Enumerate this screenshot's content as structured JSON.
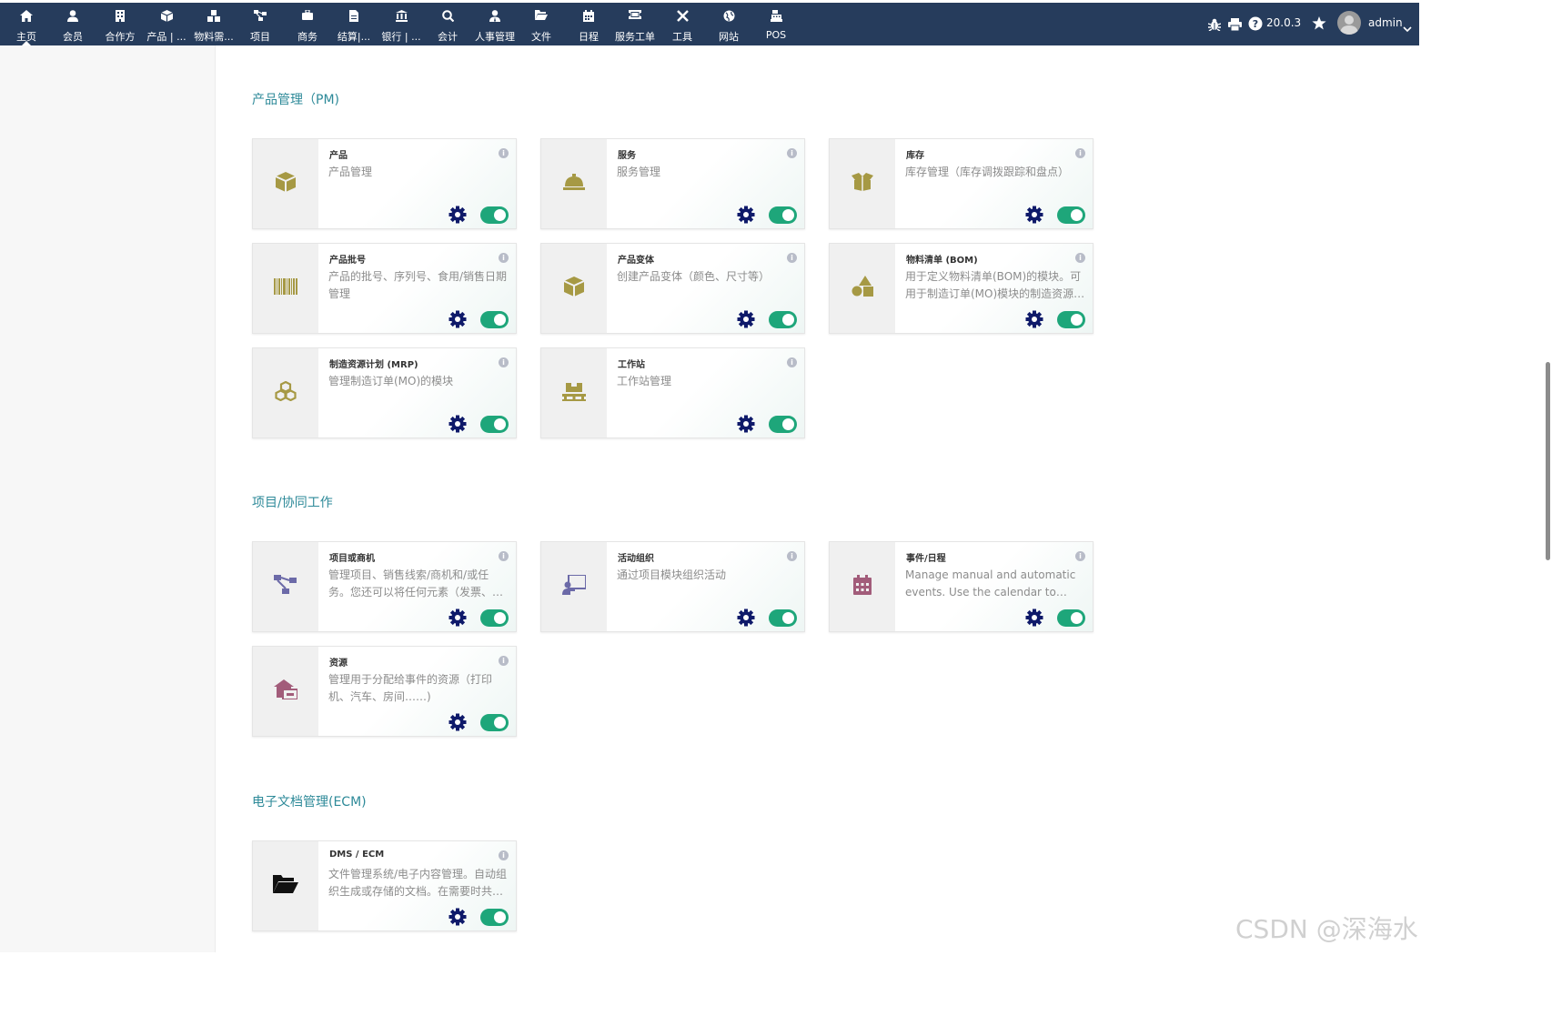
{
  "nav": {
    "items": [
      {
        "label": "主页",
        "icon": "home-icon",
        "active": true
      },
      {
        "label": "会员",
        "icon": "user-icon"
      },
      {
        "label": "合作方",
        "icon": "building-icon"
      },
      {
        "label": "产品 | ...",
        "icon": "cube-icon"
      },
      {
        "label": "物料需...",
        "icon": "cubes-icon"
      },
      {
        "label": "项目",
        "icon": "sitemap-icon"
      },
      {
        "label": "商务",
        "icon": "briefcase-icon"
      },
      {
        "label": "结算|...",
        "icon": "file-invoice-icon"
      },
      {
        "label": "银行 | ...",
        "icon": "bank-icon"
      },
      {
        "label": "会计",
        "icon": "search-dollar-icon"
      },
      {
        "label": "人事管理",
        "icon": "user-tie-icon"
      },
      {
        "label": "文件",
        "icon": "folder-open-icon"
      },
      {
        "label": "日程",
        "icon": "calendar-icon"
      },
      {
        "label": "服务工单",
        "icon": "ticket-icon"
      },
      {
        "label": "工具",
        "icon": "tools-icon"
      },
      {
        "label": "网站",
        "icon": "globe-icon"
      },
      {
        "label": "POS",
        "icon": "cash-register-icon"
      }
    ],
    "version": "20.0.3",
    "user": "admin"
  },
  "sections": [
    {
      "title": "产品管理（PM)",
      "cards": [
        {
          "title": "产品",
          "desc": "产品管理",
          "icon": "cube-icon",
          "color": "#a69944"
        },
        {
          "title": "服务",
          "desc": "服务管理",
          "icon": "concierge-bell-icon",
          "color": "#a69944"
        },
        {
          "title": "库存",
          "desc": "库存管理（库存调拨跟踪和盘点）",
          "icon": "box-open-icon",
          "color": "#a69944"
        },
        {
          "title": "产品批号",
          "desc": "产品的批号、序列号、食用/销售日期管理",
          "icon": "barcode-icon",
          "color": "#a69944"
        },
        {
          "title": "产品变体",
          "desc": "创建产品变体（颜色、尺寸等）",
          "icon": "cube-icon",
          "color": "#a69944"
        },
        {
          "title": "物料清单 (BOM)",
          "desc": "用于定义物料清单(BOM)的模块。可用于制造订单(MO)模块的制造资源计划",
          "icon": "shapes-icon",
          "color": "#a69944"
        },
        {
          "title": "制造资源计划 (MRP)",
          "desc": "管理制造订单(MO)的模块",
          "icon": "cubes-icon",
          "color": "#a69944"
        },
        {
          "title": "工作站",
          "desc": "工作站管理",
          "icon": "pallet-icon",
          "color": "#a69944"
        }
      ]
    },
    {
      "title": "项目/协同工作",
      "cards": [
        {
          "title": "项目或商机",
          "desc": "管理项目、销售线索/商机和/或任务。您还可以将任何元素（发票、订单、报价单等）分配给项目",
          "icon": "sitemap-icon",
          "color": "#6c6aa8"
        },
        {
          "title": "活动组织",
          "desc": "通过项目模块组织活动",
          "icon": "chalkboard-teacher-icon",
          "color": "#6c6aa8"
        },
        {
          "title": "事件/日程",
          "desc": "Manage manual and automatic events. Use the calendar to record events",
          "icon": "calendar-icon",
          "color": "#a25c7a"
        },
        {
          "title": "资源",
          "desc": "管理用于分配给事件的资源（打印机、汽车、房间……)",
          "icon": "house-user-icon",
          "color": "#a25c7a"
        }
      ]
    },
    {
      "title": "电子文档管理(ECM)",
      "cards": [
        {
          "title": "DMS / ECM",
          "desc": "文件管理系统/电子内容管理。自动组织生成或存储的文档。在需要时共享它们",
          "icon": "folder-open-icon",
          "color": "#111111"
        }
      ]
    }
  ],
  "watermark": "CSDN @深海水",
  "colors": {
    "topbar": "#263c5c",
    "section_title": "#2e8a99",
    "toggle_on": "#1ea67a",
    "gear": "#0f1a6a"
  }
}
